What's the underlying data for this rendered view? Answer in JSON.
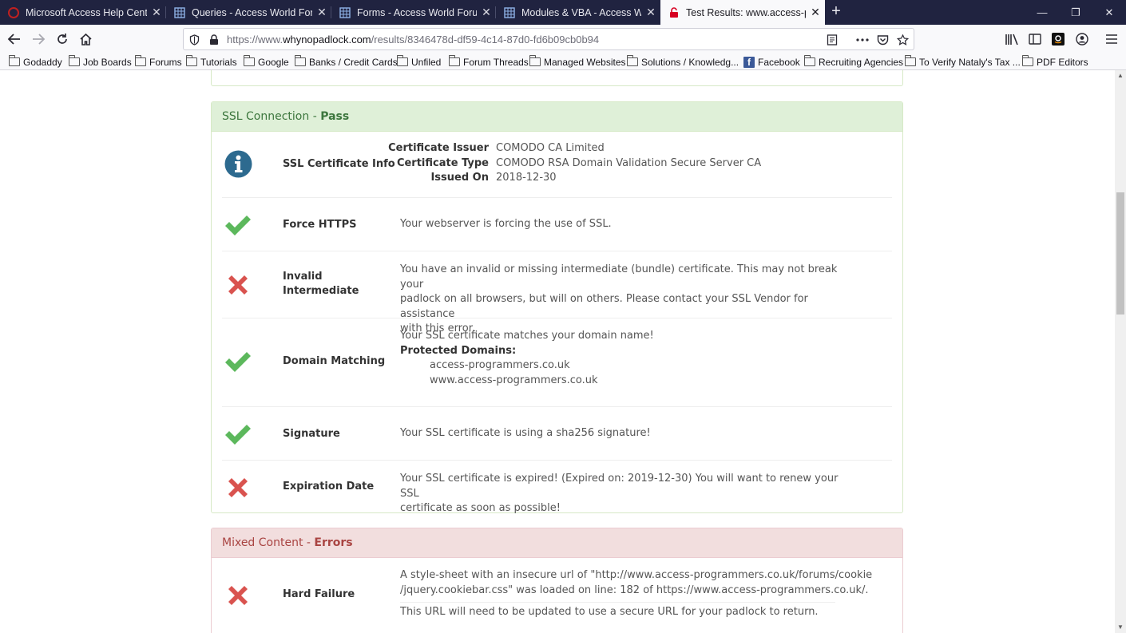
{
  "tabs": [
    {
      "title": "Microsoft Access Help Center",
      "icon": "access-icon",
      "close": "✕"
    },
    {
      "title": "Queries - Access World Forums",
      "icon": "forum-icon",
      "close": "✕"
    },
    {
      "title": "Forms - Access World Forums",
      "icon": "forum-icon",
      "close": "✕"
    },
    {
      "title": "Modules & VBA - Access World",
      "icon": "forum-icon",
      "close": "✕"
    },
    {
      "title": "Test Results: www.access-progr",
      "icon": "broken-lock-icon",
      "close": "✕",
      "active": true
    }
  ],
  "window_controls": {
    "minimize": "—",
    "restore": "❐",
    "close": "✕",
    "new_tab": "+"
  },
  "url": {
    "prefix": "https://www.",
    "domain": "whynopadlock.com",
    "path": "/results/8346478d-df59-4c14-87d0-fd6b09cb0b94"
  },
  "bookmarks": [
    {
      "label": "Godaddy",
      "icon": "folder-icon"
    },
    {
      "label": "Job Boards",
      "icon": "folder-icon"
    },
    {
      "label": "Forums",
      "icon": "folder-icon"
    },
    {
      "label": "Tutorials",
      "icon": "folder-icon"
    },
    {
      "label": "Google",
      "icon": "folder-icon"
    },
    {
      "label": "Banks / Credit Cards",
      "icon": "folder-icon"
    },
    {
      "label": "Unfiled",
      "icon": "folder-icon"
    },
    {
      "label": "Forum Threads",
      "icon": "folder-icon"
    },
    {
      "label": "Managed Websites",
      "icon": "folder-icon"
    },
    {
      "label": "Solutions / Knowledg...",
      "icon": "folder-icon"
    },
    {
      "label": "Facebook",
      "icon": "facebook-icon"
    },
    {
      "label": "Recruiting Agencies",
      "icon": "folder-icon"
    },
    {
      "label": "To Verify Nataly's Tax ...",
      "icon": "folder-icon"
    },
    {
      "label": "PDF Editors",
      "icon": "folder-icon"
    }
  ],
  "ssl": {
    "title": "SSL Connection",
    "sep": " - ",
    "status": "Pass",
    "cert": {
      "label": "SSL Certificate Info",
      "issuer_key": "Certificate Issuer",
      "issuer": "COMODO CA Limited",
      "type_key": "Certificate Type",
      "type": "COMODO RSA Domain Validation Secure Server CA",
      "issued_key": "Issued On",
      "issued": "2018-12-30"
    },
    "rows": [
      {
        "label": "Force HTTPS",
        "result": "pass",
        "desc": "Your webserver is forcing the use of SSL."
      },
      {
        "label_1": "Invalid",
        "label_2": "Intermediate",
        "result": "fail",
        "desc_1": "You have an invalid or missing intermediate (bundle) certificate. This may not break your",
        "desc_2": "padlock on all browsers, but will on others. Please contact your SSL Vendor for assistance",
        "desc_3": "with this error."
      },
      {
        "label": "Domain Matching",
        "result": "pass",
        "desc": "Your SSL certificate matches your domain name!",
        "protected_label": "Protected Domains:",
        "domains": [
          "access-programmers.co.uk",
          "www.access-programmers.co.uk"
        ]
      },
      {
        "label": "Signature",
        "result": "pass",
        "desc": "Your SSL certificate is using a sha256 signature!"
      },
      {
        "label": "Expiration Date",
        "result": "fail",
        "desc_1": "Your SSL certificate is expired! (Expired on: 2019-12-30) You will want to renew your SSL",
        "desc_2": "certificate as soon as possible!"
      }
    ]
  },
  "mixed": {
    "title": "Mixed Content",
    "sep": " - ",
    "status": "Errors",
    "rows": [
      {
        "label": "Hard Failure",
        "result": "fail",
        "desc_1": "A style-sheet with an insecure url of \"http://www.access-programmers.co.uk/forums/cookie",
        "desc_2": "/jquery.cookiebar.css\" was loaded on line: 182 of https://www.access-programmers.co.uk/.",
        "desc_3": "This URL will need to be updated to use a secure URL for your padlock to return."
      }
    ]
  },
  "colors": {
    "pass": "#5cb85c",
    "fail": "#d9534f",
    "info": "#2d6a8f",
    "tabbar": "#202340"
  }
}
